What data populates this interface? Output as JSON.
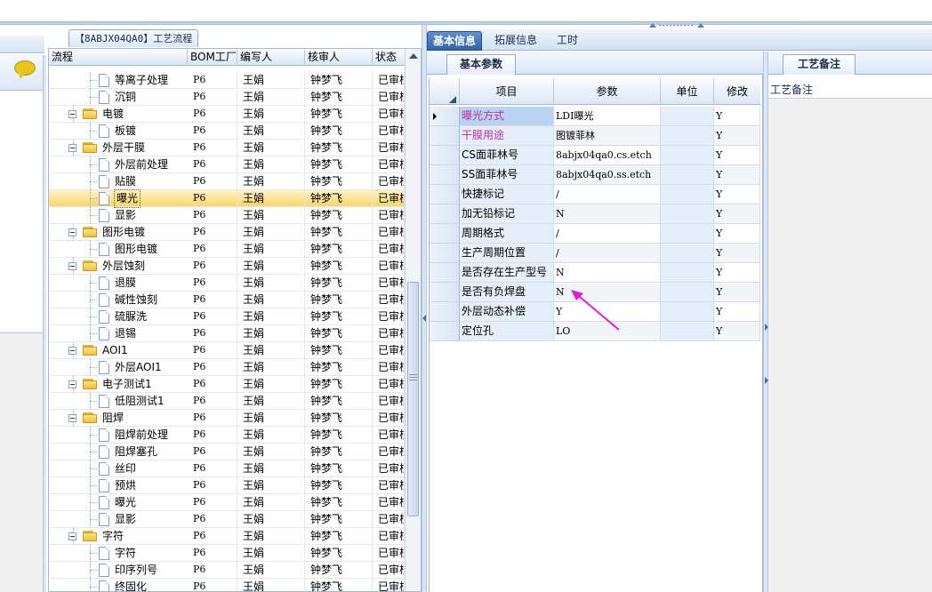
{
  "left": {
    "section_title": "【8ABJX04QA0】工艺流程"
  },
  "tree": {
    "columns": [
      "流程",
      "BOM工厂",
      "编写人",
      "核审人",
      "状态"
    ],
    "rows": [
      {
        "label": "等离子处理",
        "type": "item",
        "bom": "P6",
        "writer": "王娟",
        "reviewer": "钟梦飞",
        "status": "已审核"
      },
      {
        "label": "沉铜",
        "type": "item",
        "bom": "P6",
        "writer": "王娟",
        "reviewer": "钟梦飞",
        "status": "已审核"
      },
      {
        "label": "电镀",
        "type": "folder",
        "bom": "P6",
        "writer": "王娟",
        "reviewer": "钟梦飞",
        "status": "已审核"
      },
      {
        "label": "板镀",
        "type": "item",
        "bom": "P6",
        "writer": "王娟",
        "reviewer": "钟梦飞",
        "status": "已审核"
      },
      {
        "label": "外层干膜",
        "type": "folder",
        "bom": "P6",
        "writer": "王娟",
        "reviewer": "钟梦飞",
        "status": "已审核"
      },
      {
        "label": "外层前处理",
        "type": "item",
        "bom": "P6",
        "writer": "王娟",
        "reviewer": "钟梦飞",
        "status": "已审核"
      },
      {
        "label": "贴膜",
        "type": "item",
        "bom": "P6",
        "writer": "王娟",
        "reviewer": "钟梦飞",
        "status": "已审核"
      },
      {
        "label": "曝光",
        "type": "item",
        "bom": "P6",
        "writer": "王娟",
        "reviewer": "钟梦飞",
        "status": "已审核",
        "selected": true
      },
      {
        "label": "显影",
        "type": "item",
        "bom": "P6",
        "writer": "王娟",
        "reviewer": "钟梦飞",
        "status": "已审核"
      },
      {
        "label": "图形电镀",
        "type": "folder",
        "bom": "P6",
        "writer": "王娟",
        "reviewer": "钟梦飞",
        "status": "已审核"
      },
      {
        "label": "图形电镀",
        "type": "item",
        "bom": "P6",
        "writer": "王娟",
        "reviewer": "钟梦飞",
        "status": "已审核"
      },
      {
        "label": "外层蚀刻",
        "type": "folder",
        "bom": "P6",
        "writer": "王娟",
        "reviewer": "钟梦飞",
        "status": "已审核"
      },
      {
        "label": "退膜",
        "type": "item",
        "bom": "P6",
        "writer": "王娟",
        "reviewer": "钟梦飞",
        "status": "已审核"
      },
      {
        "label": "碱性蚀刻",
        "type": "item",
        "bom": "P6",
        "writer": "王娟",
        "reviewer": "钟梦飞",
        "status": "已审核"
      },
      {
        "label": "硫脲洗",
        "type": "item",
        "bom": "P6",
        "writer": "王娟",
        "reviewer": "钟梦飞",
        "status": "已审核"
      },
      {
        "label": "退锡",
        "type": "item",
        "bom": "P6",
        "writer": "王娟",
        "reviewer": "钟梦飞",
        "status": "已审核"
      },
      {
        "label": "AOI1",
        "type": "folder",
        "bom": "P6",
        "writer": "王娟",
        "reviewer": "钟梦飞",
        "status": "已审核"
      },
      {
        "label": "外层AOI1",
        "type": "item",
        "bom": "P6",
        "writer": "王娟",
        "reviewer": "钟梦飞",
        "status": "已审核"
      },
      {
        "label": "电子测试1",
        "type": "folder",
        "bom": "P6",
        "writer": "王娟",
        "reviewer": "钟梦飞",
        "status": "已审核"
      },
      {
        "label": "低阻测试1",
        "type": "item",
        "bom": "P6",
        "writer": "王娟",
        "reviewer": "钟梦飞",
        "status": "已审核"
      },
      {
        "label": "阻焊",
        "type": "folder",
        "bom": "P6",
        "writer": "王娟",
        "reviewer": "钟梦飞",
        "status": "已审核"
      },
      {
        "label": "阻焊前处理",
        "type": "item",
        "bom": "P6",
        "writer": "王娟",
        "reviewer": "钟梦飞",
        "status": "已审核"
      },
      {
        "label": "阻焊塞孔",
        "type": "item",
        "bom": "P6",
        "writer": "王娟",
        "reviewer": "钟梦飞",
        "status": "已审核"
      },
      {
        "label": "丝印",
        "type": "item",
        "bom": "P6",
        "writer": "王娟",
        "reviewer": "钟梦飞",
        "status": "已审核"
      },
      {
        "label": "预烘",
        "type": "item",
        "bom": "P6",
        "writer": "王娟",
        "reviewer": "钟梦飞",
        "status": "已审核"
      },
      {
        "label": "曝光",
        "type": "item",
        "bom": "P6",
        "writer": "王娟",
        "reviewer": "钟梦飞",
        "status": "已审核"
      },
      {
        "label": "显影",
        "type": "item",
        "bom": "P6",
        "writer": "王娟",
        "reviewer": "钟梦飞",
        "status": "已审核"
      },
      {
        "label": "字符",
        "type": "folder",
        "bom": "P6",
        "writer": "王娟",
        "reviewer": "钟梦飞",
        "status": "已审核"
      },
      {
        "label": "字符",
        "type": "item",
        "bom": "P6",
        "writer": "王娟",
        "reviewer": "钟梦飞",
        "status": "已审核"
      },
      {
        "label": "印序列号",
        "type": "item",
        "bom": "P6",
        "writer": "王娟",
        "reviewer": "钟梦飞",
        "status": "已审核"
      },
      {
        "label": "终固化",
        "type": "item",
        "bom": "P6",
        "writer": "王娟",
        "reviewer": "钟梦飞",
        "status": "已审核"
      }
    ]
  },
  "tabs": {
    "items": [
      "基本信息",
      "拓展信息",
      "工时"
    ],
    "active_index": 0
  },
  "params": {
    "subtab": "基本参数",
    "columns": [
      "项目",
      "参数",
      "单位",
      "修改"
    ],
    "rows": [
      {
        "item": "曝光方式",
        "value": "LDI曝光",
        "unit": "",
        "mod": "Y",
        "magenta": true,
        "current": true
      },
      {
        "item": "干膜用途",
        "value": "图镀菲林",
        "unit": "",
        "mod": "Y",
        "magenta": true
      },
      {
        "item": "CS面菲林号",
        "value": "8abjx04qa0.cs.etch",
        "unit": "",
        "mod": "Y"
      },
      {
        "item": "SS面菲林号",
        "value": "8abjx04qa0.ss.etch",
        "unit": "",
        "mod": "Y"
      },
      {
        "item": "快捷标记",
        "value": "/",
        "unit": "",
        "mod": "Y"
      },
      {
        "item": "加无铅标记",
        "value": "N",
        "unit": "",
        "mod": "Y"
      },
      {
        "item": "周期格式",
        "value": "/",
        "unit": "",
        "mod": "Y"
      },
      {
        "item": "生产周期位置",
        "value": "/",
        "unit": "",
        "mod": "Y"
      },
      {
        "item": "是否存在生产型号",
        "value": "N",
        "unit": "",
        "mod": "Y"
      },
      {
        "item": "是否有负焊盘",
        "value": "N",
        "unit": "",
        "mod": "Y"
      },
      {
        "item": "外层动态补偿",
        "value": "Y",
        "unit": "",
        "mod": "Y"
      },
      {
        "item": "定位孔",
        "value": "LO",
        "unit": "",
        "mod": "Y"
      }
    ]
  },
  "notes": {
    "tab": "工艺备注",
    "label": "工艺备注"
  },
  "colors": {
    "accent_tab": "#2e63ad",
    "selected_row": "#fbd46b",
    "magenta_text": "#c22fa0",
    "annotation_arrow": "#e21bd8"
  },
  "icons": {
    "chat": "chat-bubble-icon",
    "folder": "folder-icon",
    "document": "document-icon"
  }
}
